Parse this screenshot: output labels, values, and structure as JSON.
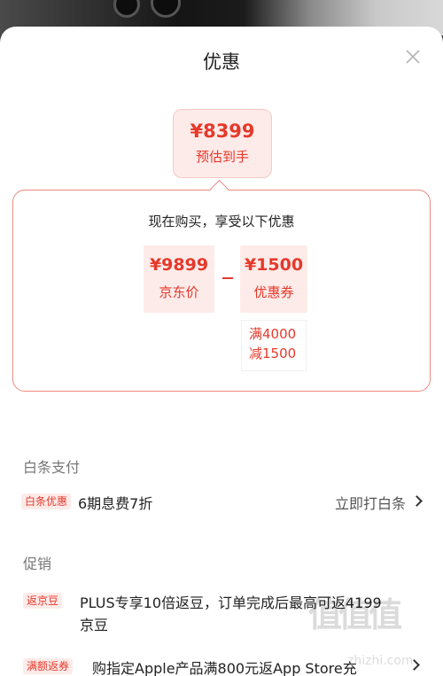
{
  "header": {
    "title": "优惠",
    "close_icon": "close-icon"
  },
  "estimate": {
    "price": "¥8399",
    "label": "预估到手"
  },
  "offer": {
    "heading": "现在购买，享受以下优惠",
    "jd_price": {
      "value": "¥9899",
      "label": "京东价"
    },
    "minus_sign": "-",
    "coupon": {
      "value": "¥1500",
      "label": "优惠券",
      "cond_line1": "满4000",
      "cond_line2": "减1500"
    }
  },
  "baitiao": {
    "section_title": "白条支付",
    "tag": "白条优惠",
    "text": "6期息费7折",
    "action": "立即打白条"
  },
  "promotions": {
    "section_title": "促销",
    "items": [
      {
        "tag": "返京豆",
        "text_line1": "PLUS专享10倍返豆，订单完成后最高可返4199",
        "text_line2": "京豆"
      },
      {
        "tag": "满额返券",
        "text_line1": "购指定Apple产品满800元返App Store充"
      }
    ]
  },
  "watermark": {
    "logo": "值值值",
    "url": "zhizhi.com"
  },
  "colors": {
    "accent": "#e5392b",
    "accent_bg": "#fdebe9",
    "border": "#ec8a80"
  }
}
